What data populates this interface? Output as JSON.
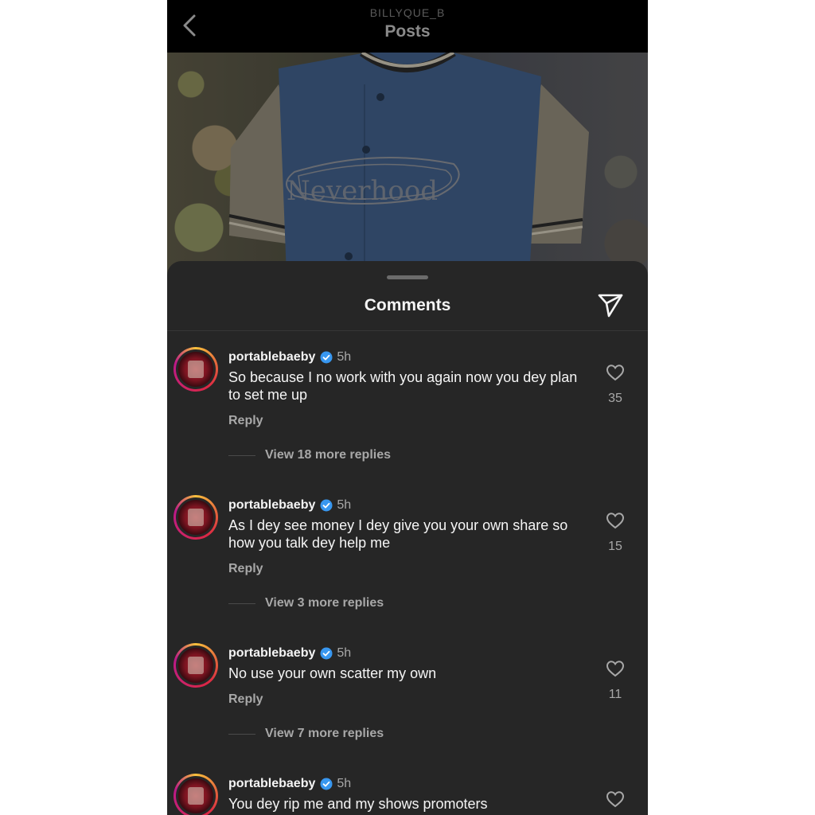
{
  "header": {
    "username": "BILLYQUE_B",
    "title": "Posts"
  },
  "post": {
    "shirt_text": "Neverhood"
  },
  "comments_sheet": {
    "title": "Comments",
    "reply_label": "Reply",
    "comments": [
      {
        "username": "portablebaeby",
        "time": "5h",
        "text": "So because I no work with you again now you dey plan to set me up",
        "likes": "35",
        "view_more": "View 18 more replies"
      },
      {
        "username": "portablebaeby",
        "time": "5h",
        "text": "As I dey see money I dey give you your own share so how you talk dey help me",
        "likes": "15",
        "view_more": "View 3 more replies"
      },
      {
        "username": "portablebaeby",
        "time": "5h",
        "text": "No use your own scatter my own",
        "likes": "11",
        "view_more": "View 7 more replies"
      },
      {
        "username": "portablebaeby",
        "time": "5h",
        "text": "You dey rip me and my shows promoters",
        "likes": "",
        "view_more": ""
      }
    ]
  },
  "colors": {
    "verified": "#3897f0",
    "sheet_bg": "#262626",
    "header_bg": "#000000"
  },
  "icons": {
    "back": "chevron-left-icon",
    "send": "paper-plane-icon",
    "like": "heart-icon",
    "verified": "verified-badge-icon"
  }
}
